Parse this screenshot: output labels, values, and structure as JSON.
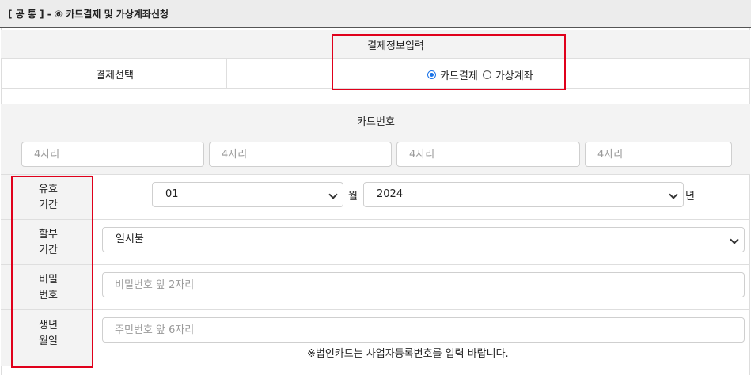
{
  "page": {
    "title": "[ 공 통 ] - ⑥ 카드결제 및 가상계좌신청"
  },
  "payment_info": {
    "header": "결제정보입력",
    "select_label": "결제선택",
    "options": [
      {
        "label": "카드결제",
        "checked": true
      },
      {
        "label": "가상계좌",
        "checked": false
      }
    ]
  },
  "card": {
    "header": "카드번호",
    "segment_placeholder": "4자리",
    "expiry": {
      "label_line1": "유효",
      "label_line2": "기간",
      "month_value": "01",
      "month_unit": "월",
      "year_value": "2024",
      "year_unit": "년"
    },
    "installment": {
      "label_line1": "할부",
      "label_line2": "기간",
      "value": "일시불"
    },
    "password": {
      "label_line1": "비밀",
      "label_line2": "번호",
      "placeholder": "비밀번호 앞 2자리"
    },
    "birth": {
      "label_line1": "생년",
      "label_line2": "월일",
      "placeholder": "주민번호 앞 6자리"
    },
    "note": "※법인카드는 사업자등록번호를 입력 바랍니다."
  },
  "colors": {
    "highlight": "#e0001b",
    "radio_accent": "#1a73e8"
  }
}
